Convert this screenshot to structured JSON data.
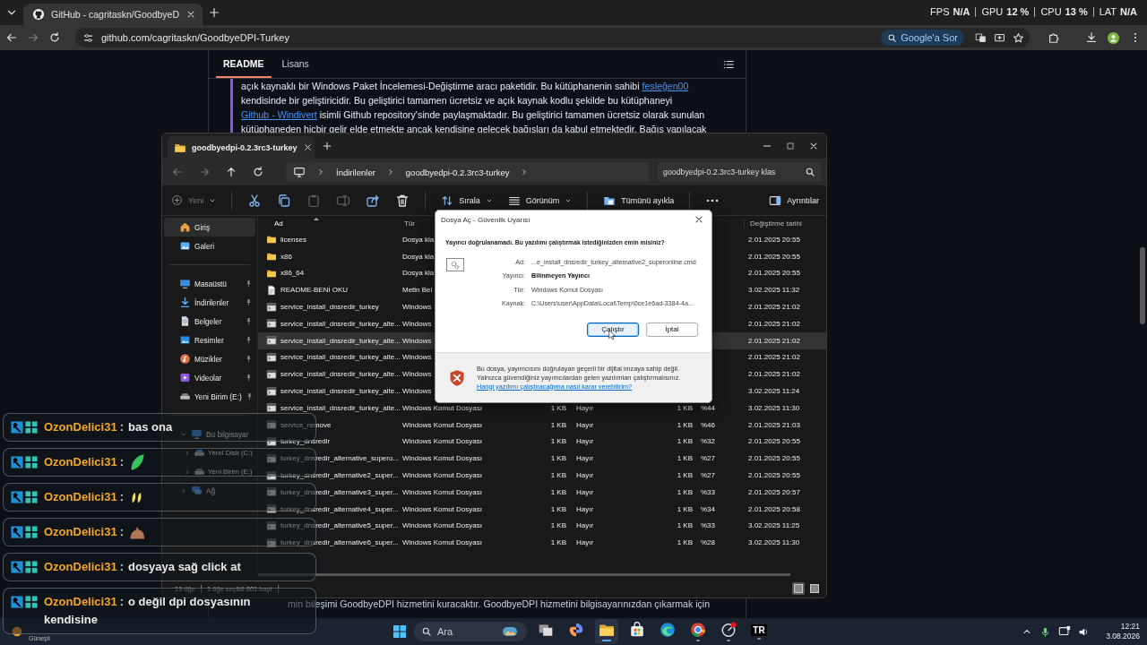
{
  "browser": {
    "tab": {
      "title": "GitHub - cagritaskn/GoodbyeD",
      "selected": true
    },
    "nav": [
      {
        "disabled": false
      },
      {
        "disabled": true
      }
    ],
    "url": "github.com/cagritaskn/GoodbyeDPI-Turkey",
    "ask_button": "Google'a Sor"
  },
  "stats": [
    {
      "label": "FPS",
      "value": "N/A"
    },
    {
      "label": "GPU",
      "value": "12 %"
    },
    {
      "label": "CPU",
      "value": "13 %"
    },
    {
      "label": "LAT",
      "value": "N/A"
    }
  ],
  "readme": {
    "tabs": [
      {
        "label": "README",
        "selected": true
      },
      {
        "label": "Lisans",
        "selected": false
      }
    ],
    "paragraph": [
      {
        "text": "açık kaynaklı bir Windows Paket İncelemesi-Değiştirme aracı paketidir. Bu kütüphanenin sahibi ",
        "link": false
      },
      {
        "text": "fesleğen00",
        "link": true
      },
      {
        "text": " kendisinde bir geliştiricidir. Bu geliştirici tamamen ücretsiz ve açık kaynak kodlu şekilde bu kütüphaneyi ",
        "link": false
      },
      {
        "text": "Github - Windivert",
        "link": true
      },
      {
        "text": " isimli Github repository'sinde paylaşmaktadır. Bu geliştirici tamamen ücretsiz olarak sunulan kütüphaneden hiçbir gelir elde etmekte ancak kendisine gelecek bağışları da kabul etmektedir. Bağış yapılacak",
        "link": false
      }
    ],
    "bottom_line": "min bileşimi GoodbyeDPI hizmetini kuracaktır. GoodbyeDPI hizmetini bilgisayarınızdan çıkarmak için"
  },
  "explorer": {
    "tab": {
      "title": "goodbyedpi-0.2.3rc3-turkey",
      "selected": true
    },
    "nav_buttons": [
      {
        "disabled": true
      },
      {
        "disabled": true
      },
      {
        "disabled": false
      },
      {
        "disabled": false
      }
    ],
    "breadcrumbs": [
      "İndirilenler",
      "goodbyedpi-0.2.3rc3-turkey"
    ],
    "search": {
      "placeholder": "goodbyedpi-0.2.3rc3-turkey klas"
    },
    "toolbar": {
      "new_button": {
        "label": "Yeni",
        "disabled": true
      },
      "icon_buttons": [
        {
          "disabled": false
        },
        {
          "disabled": false
        },
        {
          "disabled": true
        },
        {
          "disabled": true
        },
        {
          "disabled": false
        },
        {
          "disabled": false
        }
      ],
      "sort_button": "Sırala",
      "view_button": "Görünüm",
      "extract_button": "Tümünü ayıkla",
      "details_button": "Ayrıntılar"
    },
    "sidebar": {
      "top": [
        {
          "label": "Giriş",
          "kind": "home",
          "selected": true
        },
        {
          "label": "Galeri",
          "kind": "gallery",
          "selected": false
        }
      ],
      "pinned": [
        {
          "label": "Masaüstü",
          "kind": "desktop",
          "selected": false
        },
        {
          "label": "İndirilenler",
          "kind": "downloads",
          "selected": false
        },
        {
          "label": "Belgeler",
          "kind": "documents",
          "selected": false
        },
        {
          "label": "Resimler",
          "kind": "pictures",
          "selected": false
        },
        {
          "label": "Müzikler",
          "kind": "music",
          "selected": false
        },
        {
          "label": "Videolar",
          "kind": "videos",
          "selected": false
        },
        {
          "label": "Yeni Birim (E:)",
          "kind": "drive",
          "selected": false
        }
      ],
      "tree": [
        {
          "label": "Bu bilgisayar",
          "kind": "computer",
          "expanded": true,
          "selected": false,
          "children": [
            {
              "label": "Yerel Disk (C:)",
              "kind": "disk",
              "expanded": false,
              "selected": false
            },
            {
              "label": "Yeni Birim (E:)",
              "kind": "drive",
              "expanded": false,
              "selected": false
            }
          ]
        },
        {
          "label": "Ağ",
          "kind": "network",
          "expanded": false,
          "selected": false
        }
      ]
    },
    "columns": [
      {
        "label": "Ad",
        "sorted": true
      },
      {
        "label": "Tür",
        "sorted": false
      },
      {
        "label": "Değiştirme tarihi",
        "sorted": false
      }
    ],
    "rows": [
      {
        "kind": "folder",
        "name": "licenses",
        "type": "Dosya kla",
        "modified": "2.01.2025 20:55",
        "selected": false
      },
      {
        "kind": "folder",
        "name": "x86",
        "type": "Dosya kla",
        "modified": "2.01.2025 20:55",
        "selected": false
      },
      {
        "kind": "folder",
        "name": "x86_64",
        "type": "Dosya kla",
        "modified": "2.01.2025 20:55",
        "selected": false
      },
      {
        "kind": "text",
        "name": "README-BENİ OKU",
        "type": "Metin Bel",
        "modified": "3.02.2025 11:32",
        "selected": false
      },
      {
        "kind": "script",
        "name": "service_install_dnsredir_turkey",
        "type": "Windows",
        "modified": "2.01.2025 21:02",
        "selected": false
      },
      {
        "kind": "script",
        "name": "service_install_dnsredir_turkey_alte...",
        "type": "Windows",
        "modified": "2.01.2025 21:02",
        "selected": false
      },
      {
        "kind": "script",
        "name": "service_install_dnsredir_turkey_alte...",
        "type": "Windows",
        "modified": "2.01.2025 21:02",
        "selected": true
      },
      {
        "kind": "script",
        "name": "service_install_dnsredir_turkey_alte...",
        "type": "Windows",
        "modified": "2.01.2025 21:02",
        "selected": false
      },
      {
        "kind": "script",
        "name": "service_install_dnsredir_turkey_alte...",
        "type": "Windows",
        "modified": "2.01.2025 21:02",
        "selected": false
      },
      {
        "kind": "script",
        "name": "service_install_dnsredir_turkey_alte...",
        "type": "Windows",
        "modified": "3.02.2025 11:24",
        "selected": false
      },
      {
        "kind": "script",
        "name": "service_install_dnsredir_turkey_alte...",
        "type": "Windows Komut Dosyası",
        "column_3": "1 KB",
        "column_4": "Hayır",
        "column_5": "1 KB",
        "column_6": "%44",
        "modified": "3.02.2025 11:30",
        "selected": false
      },
      {
        "kind": "script",
        "name": "service_remove",
        "type": "Windows Komut Dosyası",
        "column_3": "1 KB",
        "column_4": "Hayır",
        "column_5": "1 KB",
        "column_6": "%46",
        "modified": "2.01.2025 21:03",
        "selected": false
      },
      {
        "kind": "script",
        "name": "turkey_dnsredir",
        "type": "Windows Komut Dosyası",
        "column_3": "1 KB",
        "column_4": "Hayır",
        "column_5": "1 KB",
        "column_6": "%32",
        "modified": "2.01.2025 20:55",
        "selected": false
      },
      {
        "kind": "script",
        "name": "turkey_dnsredir_alternative_supero...",
        "type": "Windows Komut Dosyası",
        "column_3": "1 KB",
        "column_4": "Hayır",
        "column_5": "1 KB",
        "column_6": "%27",
        "modified": "2.01.2025 20:55",
        "selected": false
      },
      {
        "kind": "script",
        "name": "turkey_dnsredir_alternative2_super...",
        "type": "Windows Komut Dosyası",
        "column_3": "1 KB",
        "column_4": "Hayır",
        "column_5": "1 KB",
        "column_6": "%27",
        "modified": "2.01.2025 20:55",
        "selected": false
      },
      {
        "kind": "script",
        "name": "turkey_dnsredir_alternative3_super...",
        "type": "Windows Komut Dosyası",
        "column_3": "1 KB",
        "column_4": "Hayır",
        "column_5": "1 KB",
        "column_6": "%33",
        "modified": "2.01.2025 20:57",
        "selected": false
      },
      {
        "kind": "script",
        "name": "turkey_dnsredir_alternative4_super...",
        "type": "Windows Komut Dosyası",
        "column_3": "1 KB",
        "column_4": "Hayır",
        "column_5": "1 KB",
        "column_6": "%34",
        "modified": "2.01.2025 20:58",
        "selected": false
      },
      {
        "kind": "script",
        "name": "turkey_dnsredir_alternative5_super...",
        "type": "Windows Komut Dosyası",
        "column_3": "1 KB",
        "column_4": "Hayır",
        "column_5": "1 KB",
        "column_6": "%33",
        "modified": "3.02.2025 11:25",
        "selected": false
      },
      {
        "kind": "script",
        "name": "turkey_dnsredir_alternative6_super...",
        "type": "Windows Komut Dosyası",
        "column_3": "1 KB",
        "column_4": "Hayır",
        "column_5": "1 KB",
        "column_6": "%28",
        "modified": "3.02.2025 11:30",
        "selected": false
      }
    ],
    "status": [
      "19 öğe",
      "1 öğe seçildi  801 bayt"
    ],
    "views": [
      {
        "selected": true
      },
      {
        "selected": false
      }
    ]
  },
  "dialog": {
    "title": "Dosya Aç - Güvenlik Uyarısı",
    "question": "Yayıncı doğrulanamadı. Bu yazılımı çalıştırmak istediğinizden emin misiniz?",
    "fields": [
      {
        "label": "Ad:",
        "value": "...e_install_dnsredir_turkey_alternative2_superonline.cmd",
        "kind": "plain"
      },
      {
        "label": "Yayıncı:",
        "value": "Bilinmeyen Yayıncı",
        "kind": "strong"
      },
      {
        "label": "Tür:",
        "value": "Windows Komut Dosyası",
        "kind": "plain"
      },
      {
        "label": "Kaynak:",
        "value": "C:\\Users\\user\\AppData\\Local\\Temp\\0ce1e6ad-3384-4a...",
        "kind": "plain"
      }
    ],
    "buttons": [
      {
        "label": "Çalıştır",
        "selected": true
      },
      {
        "label": "İptal",
        "selected": false
      }
    ],
    "warning": "Bu dosya, yayımcısını doğrulayan geçerli bir dijital imzaya sahip değil. Yalnızca güvendiğiniz yayımcılardan gelen yazılımları çalıştırmalısınız.",
    "help_link": "Hangi yazılımı çalıştıracağıma nasıl karar verebilirim?"
  },
  "chat": [
    {
      "user": "OzonDelici31",
      "separator": ":",
      "kind": "text",
      "text": "bas ona"
    },
    {
      "user": "OzonDelici31",
      "separator": ":",
      "kind": "emote"
    },
    {
      "user": "OzonDelici31",
      "separator": ":",
      "kind": "emote"
    },
    {
      "user": "OzonDelici31",
      "separator": ":",
      "kind": "emote"
    },
    {
      "user": "OzonDelici31",
      "separator": ":",
      "kind": "text",
      "text": "dosyaya sağ click at"
    },
    {
      "user": "OzonDelici31",
      "separator": ":",
      "kind": "text",
      "text": "o değil dpi dosyasının kendisine"
    }
  ],
  "taskbar": {
    "weather": "Güneşli",
    "search": {
      "placeholder": "Ara"
    },
    "apps": [
      {
        "kind": "taskview",
        "open": false,
        "selected": false
      },
      {
        "kind": "swirl",
        "open": false,
        "selected": false
      },
      {
        "kind": "files",
        "open": true,
        "selected": true
      },
      {
        "kind": "store",
        "open": false,
        "selected": false
      },
      {
        "kind": "wave",
        "open": false,
        "selected": false
      },
      {
        "kind": "browser",
        "open": true,
        "selected": false
      },
      {
        "kind": "gauge",
        "open": true,
        "selected": false
      },
      {
        "kind": "label",
        "label": "TR",
        "open": true,
        "selected": false
      }
    ],
    "time": "12:21",
    "date": "3.08.2026"
  }
}
